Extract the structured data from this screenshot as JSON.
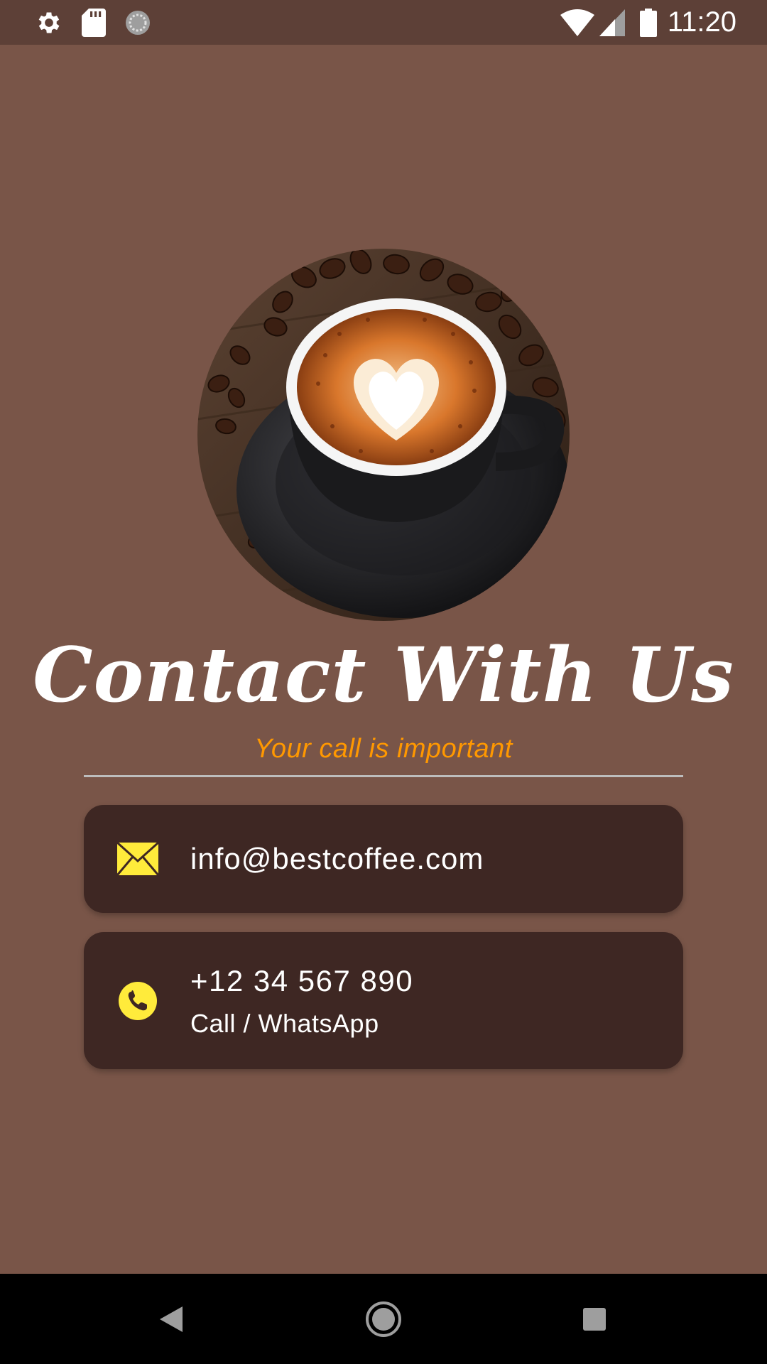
{
  "status_bar": {
    "time": "11:20",
    "icons": [
      "gear-icon",
      "sd-card-icon",
      "sync-icon",
      "wifi-icon",
      "signal-icon",
      "battery-icon"
    ]
  },
  "hero": {
    "image": "latte-art-coffee-cup-with-beans"
  },
  "page": {
    "title": "Contact With Us",
    "subtitle": "Your call is important"
  },
  "contacts": {
    "email": {
      "icon": "envelope-icon",
      "value": "info@bestcoffee.com"
    },
    "phone": {
      "icon": "phone-icon",
      "value": "+12 34 567 890",
      "label": "Call / WhatsApp"
    }
  },
  "nav_bar": {
    "buttons": [
      "back-icon",
      "home-icon",
      "recents-icon"
    ]
  },
  "colors": {
    "background": "#795548",
    "status_bar": "#5d4037",
    "card": "#3e2723",
    "accent_subtitle": "#ff9800",
    "icon_yellow": "#ffeb3b"
  }
}
